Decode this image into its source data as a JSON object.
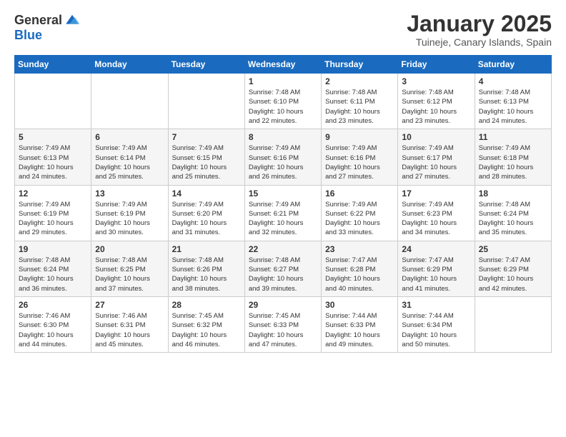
{
  "logo": {
    "general": "General",
    "blue": "Blue"
  },
  "title": {
    "month_year": "January 2025",
    "location": "Tuineje, Canary Islands, Spain"
  },
  "weekdays": [
    "Sunday",
    "Monday",
    "Tuesday",
    "Wednesday",
    "Thursday",
    "Friday",
    "Saturday"
  ],
  "weeks": [
    [
      {
        "day": "",
        "info": ""
      },
      {
        "day": "",
        "info": ""
      },
      {
        "day": "",
        "info": ""
      },
      {
        "day": "1",
        "info": "Sunrise: 7:48 AM\nSunset: 6:10 PM\nDaylight: 10 hours\nand 22 minutes."
      },
      {
        "day": "2",
        "info": "Sunrise: 7:48 AM\nSunset: 6:11 PM\nDaylight: 10 hours\nand 23 minutes."
      },
      {
        "day": "3",
        "info": "Sunrise: 7:48 AM\nSunset: 6:12 PM\nDaylight: 10 hours\nand 23 minutes."
      },
      {
        "day": "4",
        "info": "Sunrise: 7:48 AM\nSunset: 6:13 PM\nDaylight: 10 hours\nand 24 minutes."
      }
    ],
    [
      {
        "day": "5",
        "info": "Sunrise: 7:49 AM\nSunset: 6:13 PM\nDaylight: 10 hours\nand 24 minutes."
      },
      {
        "day": "6",
        "info": "Sunrise: 7:49 AM\nSunset: 6:14 PM\nDaylight: 10 hours\nand 25 minutes."
      },
      {
        "day": "7",
        "info": "Sunrise: 7:49 AM\nSunset: 6:15 PM\nDaylight: 10 hours\nand 25 minutes."
      },
      {
        "day": "8",
        "info": "Sunrise: 7:49 AM\nSunset: 6:16 PM\nDaylight: 10 hours\nand 26 minutes."
      },
      {
        "day": "9",
        "info": "Sunrise: 7:49 AM\nSunset: 6:16 PM\nDaylight: 10 hours\nand 27 minutes."
      },
      {
        "day": "10",
        "info": "Sunrise: 7:49 AM\nSunset: 6:17 PM\nDaylight: 10 hours\nand 27 minutes."
      },
      {
        "day": "11",
        "info": "Sunrise: 7:49 AM\nSunset: 6:18 PM\nDaylight: 10 hours\nand 28 minutes."
      }
    ],
    [
      {
        "day": "12",
        "info": "Sunrise: 7:49 AM\nSunset: 6:19 PM\nDaylight: 10 hours\nand 29 minutes."
      },
      {
        "day": "13",
        "info": "Sunrise: 7:49 AM\nSunset: 6:19 PM\nDaylight: 10 hours\nand 30 minutes."
      },
      {
        "day": "14",
        "info": "Sunrise: 7:49 AM\nSunset: 6:20 PM\nDaylight: 10 hours\nand 31 minutes."
      },
      {
        "day": "15",
        "info": "Sunrise: 7:49 AM\nSunset: 6:21 PM\nDaylight: 10 hours\nand 32 minutes."
      },
      {
        "day": "16",
        "info": "Sunrise: 7:49 AM\nSunset: 6:22 PM\nDaylight: 10 hours\nand 33 minutes."
      },
      {
        "day": "17",
        "info": "Sunrise: 7:49 AM\nSunset: 6:23 PM\nDaylight: 10 hours\nand 34 minutes."
      },
      {
        "day": "18",
        "info": "Sunrise: 7:48 AM\nSunset: 6:24 PM\nDaylight: 10 hours\nand 35 minutes."
      }
    ],
    [
      {
        "day": "19",
        "info": "Sunrise: 7:48 AM\nSunset: 6:24 PM\nDaylight: 10 hours\nand 36 minutes."
      },
      {
        "day": "20",
        "info": "Sunrise: 7:48 AM\nSunset: 6:25 PM\nDaylight: 10 hours\nand 37 minutes."
      },
      {
        "day": "21",
        "info": "Sunrise: 7:48 AM\nSunset: 6:26 PM\nDaylight: 10 hours\nand 38 minutes."
      },
      {
        "day": "22",
        "info": "Sunrise: 7:48 AM\nSunset: 6:27 PM\nDaylight: 10 hours\nand 39 minutes."
      },
      {
        "day": "23",
        "info": "Sunrise: 7:47 AM\nSunset: 6:28 PM\nDaylight: 10 hours\nand 40 minutes."
      },
      {
        "day": "24",
        "info": "Sunrise: 7:47 AM\nSunset: 6:29 PM\nDaylight: 10 hours\nand 41 minutes."
      },
      {
        "day": "25",
        "info": "Sunrise: 7:47 AM\nSunset: 6:29 PM\nDaylight: 10 hours\nand 42 minutes."
      }
    ],
    [
      {
        "day": "26",
        "info": "Sunrise: 7:46 AM\nSunset: 6:30 PM\nDaylight: 10 hours\nand 44 minutes."
      },
      {
        "day": "27",
        "info": "Sunrise: 7:46 AM\nSunset: 6:31 PM\nDaylight: 10 hours\nand 45 minutes."
      },
      {
        "day": "28",
        "info": "Sunrise: 7:45 AM\nSunset: 6:32 PM\nDaylight: 10 hours\nand 46 minutes."
      },
      {
        "day": "29",
        "info": "Sunrise: 7:45 AM\nSunset: 6:33 PM\nDaylight: 10 hours\nand 47 minutes."
      },
      {
        "day": "30",
        "info": "Sunrise: 7:44 AM\nSunset: 6:33 PM\nDaylight: 10 hours\nand 49 minutes."
      },
      {
        "day": "31",
        "info": "Sunrise: 7:44 AM\nSunset: 6:34 PM\nDaylight: 10 hours\nand 50 minutes."
      },
      {
        "day": "",
        "info": ""
      }
    ]
  ]
}
